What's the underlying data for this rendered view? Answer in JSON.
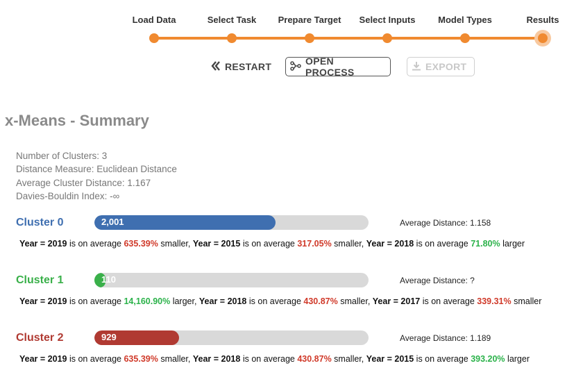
{
  "steps": [
    "Load Data",
    "Select Task",
    "Prepare Target",
    "Select Inputs",
    "Model Types",
    "Results"
  ],
  "actions": {
    "restart": "RESTART",
    "open_process": "OPEN PROCESS",
    "export": "EXPORT"
  },
  "title": "x-Means - Summary",
  "summary": [
    "Number of Clusters: 3",
    "Distance Measure: Euclidean Distance",
    "Average Cluster Distance: 1.167",
    "Davies-Bouldin Index: -∞"
  ],
  "colors": {
    "accent": "#f08a30",
    "cluster0": "#3f6fb0",
    "cluster1": "#3ab04a",
    "cluster2": "#b03a32",
    "smaller": "#d03a2a",
    "larger": "#2bb24a"
  },
  "clusters": [
    {
      "name": "Cluster 0",
      "count": "2,001",
      "fill_fraction": 0.66,
      "avg_distance": "Average Distance: 1.158",
      "desc": [
        {
          "var": "Year = 2019",
          "pct": "635.39%",
          "dir": "smaller"
        },
        {
          "var": "Year = 2015",
          "pct": "317.05%",
          "dir": "smaller"
        },
        {
          "var": "Year = 2018",
          "pct": "71.80%",
          "dir": "larger"
        }
      ]
    },
    {
      "name": "Cluster 1",
      "count": "110",
      "fill_fraction": 0.04,
      "avg_distance": "Average Distance: ?",
      "desc": [
        {
          "var": "Year = 2019",
          "pct": "14,160.90%",
          "dir": "larger"
        },
        {
          "var": "Year = 2018",
          "pct": "430.87%",
          "dir": "smaller"
        },
        {
          "var": "Year = 2017",
          "pct": "339.31%",
          "dir": "smaller"
        }
      ]
    },
    {
      "name": "Cluster 2",
      "count": "929",
      "fill_fraction": 0.31,
      "avg_distance": "Average Distance: 1.189",
      "desc": [
        {
          "var": "Year = 2019",
          "pct": "635.39%",
          "dir": "smaller"
        },
        {
          "var": "Year = 2018",
          "pct": "430.87%",
          "dir": "smaller"
        },
        {
          "var": "Year = 2015",
          "pct": "393.20%",
          "dir": "larger"
        }
      ]
    }
  ],
  "text": {
    "is_on_average": "is on average",
    "smaller": "smaller",
    "larger": "larger"
  }
}
